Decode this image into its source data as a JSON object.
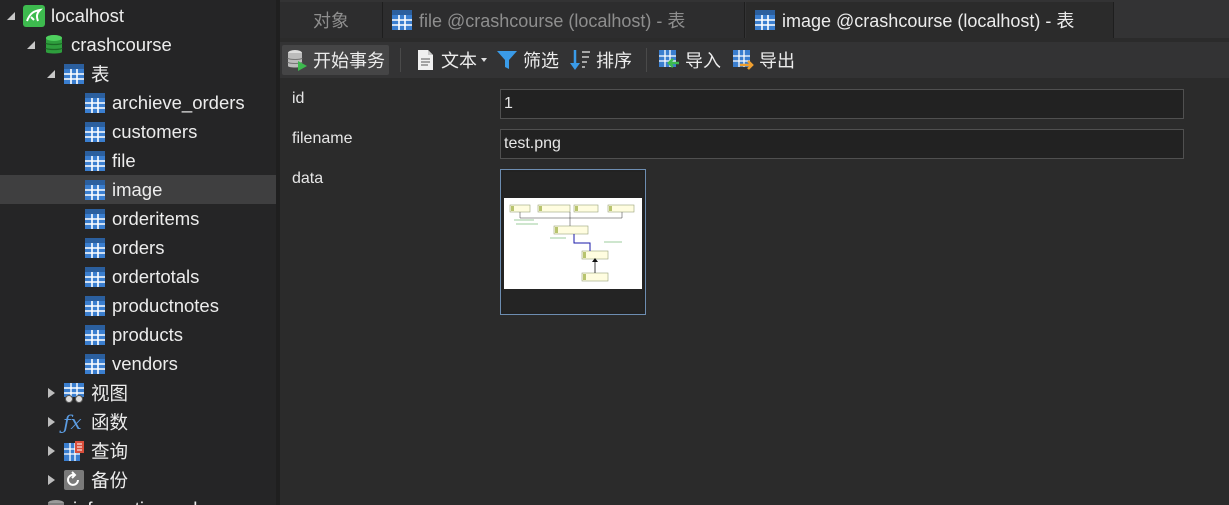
{
  "tree": {
    "connection": "localhost",
    "database": "crashcourse",
    "tables_group": "表",
    "tables": [
      "archieve_orders",
      "customers",
      "file",
      "image",
      "orderitems",
      "orders",
      "ordertotals",
      "productnotes",
      "products",
      "vendors"
    ],
    "selected_table": "image",
    "groups": [
      "视图",
      "函数",
      "查询",
      "备份"
    ],
    "next_database_partial": "information_schema"
  },
  "tabs": [
    {
      "label": "对象",
      "active": false
    },
    {
      "label": "file @crashcourse (localhost) - 表",
      "active": false
    },
    {
      "label": "image @crashcourse (localhost) - 表",
      "active": true
    }
  ],
  "toolbar": {
    "begin_transaction": "开始事务",
    "text": "文本",
    "filter": "筛选",
    "sort": "排序",
    "import": "导入",
    "export": "导出"
  },
  "form": {
    "id_label": "id",
    "id_value": "1",
    "filename_label": "filename",
    "filename_value": "test.png",
    "data_label": "data"
  },
  "colors": {
    "accent_green": "#3dba4e",
    "table_icon_blue": "#3a7ecf",
    "selected_row": "#3f3f40"
  }
}
